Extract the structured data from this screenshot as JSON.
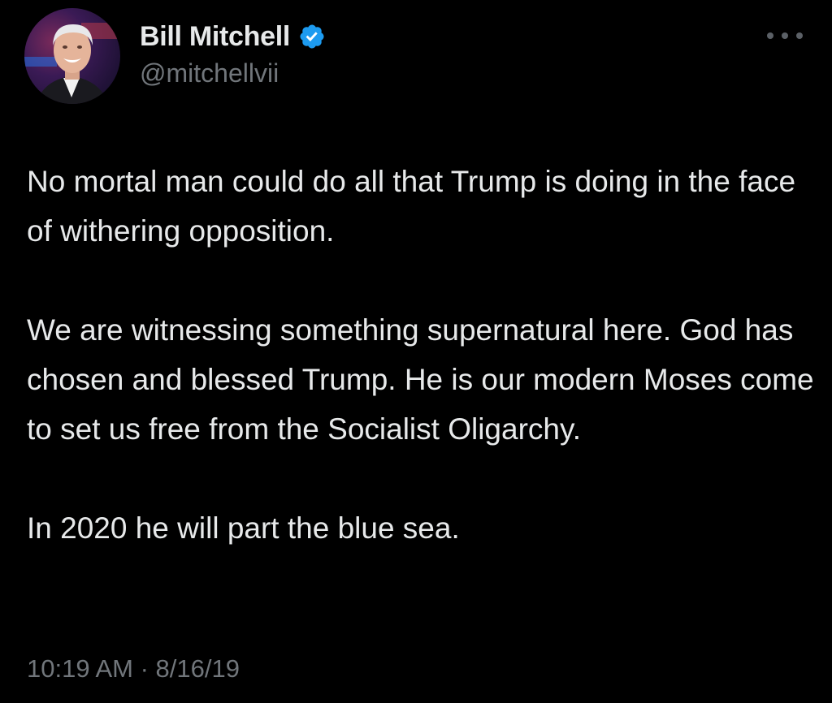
{
  "tweet": {
    "author": {
      "display_name": "Bill Mitchell",
      "handle": "@mitchellvii",
      "verified": true,
      "avatar_icon": "profile-photo"
    },
    "more_icon": "more-options-icon",
    "paragraphs": [
      "No mortal man could do all that Trump is doing in the face of withering opposition.",
      "We are witnessing something supernatural here. God has chosen and blessed Trump. He is our modern Moses come to set us free from the Socialist Oligarchy.",
      "In 2020 he will part the blue sea."
    ],
    "timestamp": "10:19 AM · 8/16/19"
  },
  "colors": {
    "background": "#000000",
    "text_primary": "#e7e9ea",
    "text_secondary": "#71767b",
    "verified_badge": "#1d9bf0"
  }
}
